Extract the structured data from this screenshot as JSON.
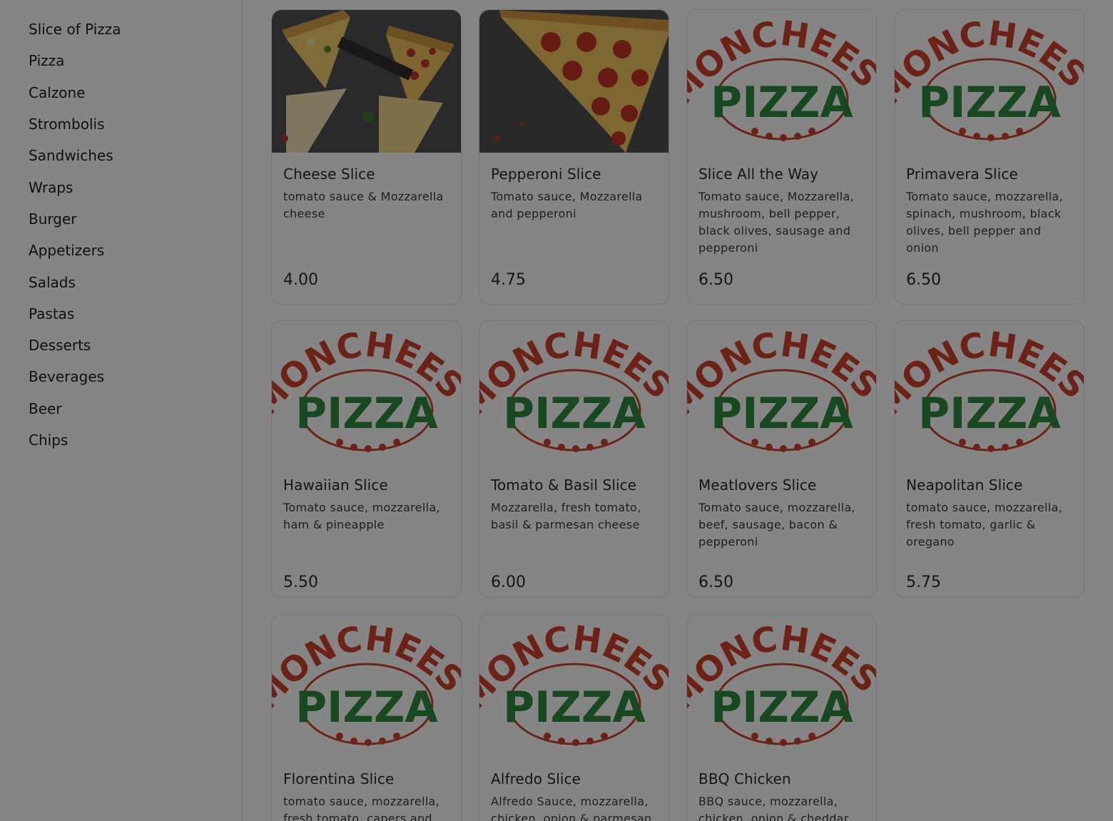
{
  "sidebar": {
    "categories": [
      {
        "label": "Slice of Pizza"
      },
      {
        "label": "Pizza"
      },
      {
        "label": "Calzone"
      },
      {
        "label": "Strombolis"
      },
      {
        "label": "Sandwiches"
      },
      {
        "label": "Wraps"
      },
      {
        "label": "Burger"
      },
      {
        "label": "Appetizers"
      },
      {
        "label": "Salads"
      },
      {
        "label": "Pastas"
      },
      {
        "label": "Desserts"
      },
      {
        "label": "Beverages"
      },
      {
        "label": "Beer"
      },
      {
        "label": "Chips"
      }
    ]
  },
  "logo": {
    "top_text": "MONCHEESE",
    "bottom_text": "PIZZA"
  },
  "items": [
    {
      "name": "Cheese Slice",
      "description": "tomato sauce & Mozzarella cheese",
      "price": "4.00",
      "image": "cheese-slice-photo"
    },
    {
      "name": "Pepperoni Slice",
      "description": "Tomato sauce, Mozzarella and pepperoni",
      "price": "4.75",
      "image": "pepperoni-slice-photo"
    },
    {
      "name": "Slice All the Way",
      "description": "Tomato sauce, Mozzarella, mushroom, bell pepper, black olives, sausage and pepperoni",
      "price": "6.50",
      "image": "moncheese-logo"
    },
    {
      "name": "Primavera Slice",
      "description": "Tomato sauce, mozzarella, spinach, mushroom, black olives, bell pepper and onion",
      "price": "6.50",
      "image": "moncheese-logo"
    },
    {
      "name": "Hawaiian Slice",
      "description": "Tomato sauce, mozzarella, ham & pineapple",
      "price": "5.50",
      "image": "moncheese-logo"
    },
    {
      "name": "Tomato & Basil Slice",
      "description": "Mozzarella, fresh tomato, basil & parmesan cheese",
      "price": "6.00",
      "image": "moncheese-logo"
    },
    {
      "name": "Meatlovers Slice",
      "description": "Tomato sauce, mozzarella, beef, sausage, bacon & pepperoni",
      "price": "6.50",
      "image": "moncheese-logo"
    },
    {
      "name": "Neapolitan Slice",
      "description": "tomato sauce, mozzarella, fresh tomato, garlic & oregano",
      "price": "5.75",
      "image": "moncheese-logo"
    },
    {
      "name": "Florentina Slice",
      "description": "tomato sauce, mozzarella, fresh tomato, capers and",
      "price": "",
      "image": "moncheese-logo"
    },
    {
      "name": "Alfredo Slice",
      "description": "Alfredo Sauce, mozzarella, chicken, onion & parmesan",
      "price": "",
      "image": "moncheese-logo"
    },
    {
      "name": "BBQ Chicken",
      "description": "BBQ sauce, mozzarella, chicken, onion & cheddar",
      "price": "",
      "image": "moncheese-logo"
    }
  ],
  "colors": {
    "logo_red": "#d2412e",
    "logo_green": "#2e8a3e",
    "overlay": "#000000"
  }
}
